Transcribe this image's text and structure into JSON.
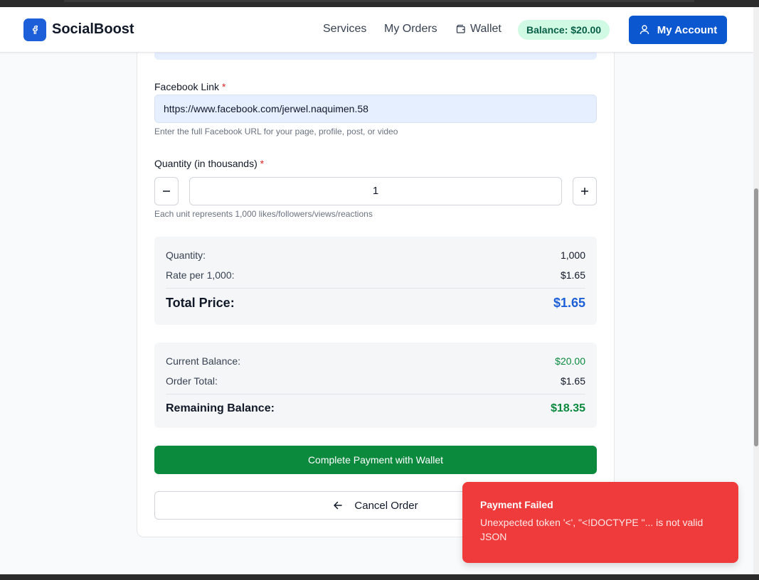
{
  "colors": {
    "brand": "#1d5fd8",
    "primary_button": "#0b57d0",
    "success_green": "#0b8a3e",
    "total_blue": "#1d5fd8",
    "toast_red": "#ef3b3b"
  },
  "header": {
    "brand": "SocialBoost",
    "logo_icon": "facebook-icon",
    "nav": {
      "services": "Services",
      "orders": "My Orders",
      "wallet": "Wallet"
    },
    "balance_badge": "Balance: $20.00",
    "account_button": "My Account"
  },
  "form": {
    "link_label": "Facebook Link",
    "required_mark": "*",
    "link_value": "https://www.facebook.com/jerwel.naquimen.58",
    "link_help": "Enter the full Facebook URL for your page, profile, post, or video",
    "quantity_label": "Quantity (in thousands)",
    "quantity_value": "1",
    "decrement_symbol": "−",
    "increment_symbol": "+",
    "quantity_help": "Each unit represents 1,000 likes/followers/views/reactions"
  },
  "price_summary": {
    "quantity_label": "Quantity:",
    "quantity_value": "1,000",
    "rate_label": "Rate per 1,000:",
    "rate_value": "$1.65",
    "total_label": "Total Price:",
    "total_value": "$1.65"
  },
  "balance_summary": {
    "current_label": "Current Balance:",
    "current_value": "$20.00",
    "order_label": "Order Total:",
    "order_value": "$1.65",
    "remaining_label": "Remaining Balance:",
    "remaining_value": "$18.35"
  },
  "actions": {
    "pay_label": "Complete Payment with Wallet",
    "cancel_label": "Cancel Order"
  },
  "toast": {
    "title": "Payment Failed",
    "message": "Unexpected token '<', \"<!DOCTYPE \"... is not valid JSON"
  }
}
